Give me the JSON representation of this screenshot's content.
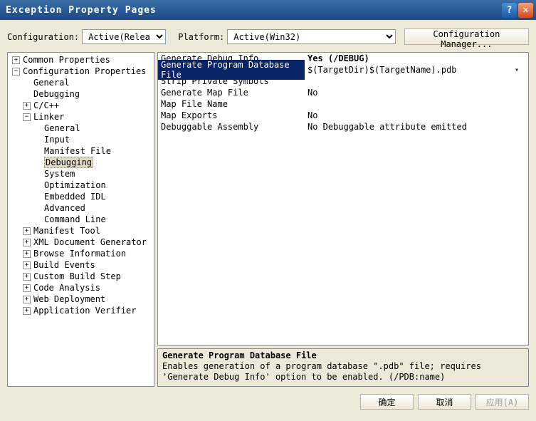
{
  "window": {
    "title": "Exception Property Pages"
  },
  "toolbar": {
    "config_label": "Configuration:",
    "config_value": "Active(Release)",
    "platform_label": "Platform:",
    "platform_value": "Active(Win32)",
    "config_mgr": "Configuration Manager..."
  },
  "tree": {
    "common_properties": "Common Properties",
    "configuration_properties": "Configuration Properties",
    "general": "General",
    "debugging": "Debugging",
    "ccpp": "C/C++",
    "linker": "Linker",
    "linker_items": {
      "general": "General",
      "input": "Input",
      "manifest_file": "Manifest File",
      "debugging": "Debugging",
      "system": "System",
      "optimization": "Optimization",
      "embedded_idl": "Embedded IDL",
      "advanced": "Advanced",
      "command_line": "Command Line"
    },
    "manifest_tool": "Manifest Tool",
    "xml_doc_gen": "XML Document Generator",
    "browse_info": "Browse Information",
    "build_events": "Build Events",
    "custom_build": "Custom Build Step",
    "code_analysis": "Code Analysis",
    "web_deployment": "Web Deployment",
    "app_verifier": "Application Verifier"
  },
  "grid": {
    "rows": [
      {
        "key": "Generate Debug Info",
        "val": "Yes (/DEBUG)",
        "bold": true
      },
      {
        "key": "Generate Program Database File",
        "val": "$(TargetDir)$(TargetName).pdb",
        "selected": true
      },
      {
        "key": "Strip Private Symbols",
        "val": ""
      },
      {
        "key": "Generate Map File",
        "val": "No"
      },
      {
        "key": "Map File Name",
        "val": ""
      },
      {
        "key": "Map Exports",
        "val": "No"
      },
      {
        "key": "Debuggable Assembly",
        "val": "No Debuggable attribute emitted"
      }
    ]
  },
  "desc": {
    "title": "Generate Program Database File",
    "body": "Enables generation of a program database \".pdb\" file; requires 'Generate Debug Info' option to be enabled.     (/PDB:name)"
  },
  "footer": {
    "ok": "确定",
    "cancel": "取消",
    "apply": "应用(A)"
  }
}
